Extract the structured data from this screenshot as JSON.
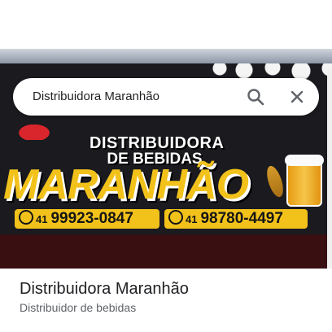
{
  "search": {
    "query": "Distribuidora Maranhão",
    "search_icon": "search-icon",
    "close_icon": "close-icon"
  },
  "photo": {
    "sign_line1": "DISTRIBUIDORA",
    "sign_line2": "DE BEBIDAS",
    "sign_brand": "MARANHÃO",
    "phone1_ddd": "41",
    "phone1_number": "99923-0847",
    "phone2_ddd": "41",
    "phone2_number": "98780-4497"
  },
  "place": {
    "title": "Distribuidora Maranhão",
    "category": "Distribuidor de bebidas"
  },
  "colors": {
    "sign_yellow": "#f2c21b",
    "text_primary": "#202124",
    "text_secondary": "#5f6368"
  }
}
